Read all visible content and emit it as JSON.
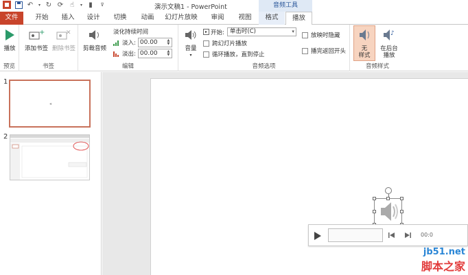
{
  "titlebar": {
    "doc_title": "演示文稿1 - PowerPoint",
    "ctx_title": "音频工具"
  },
  "tabs": [
    "文件",
    "开始",
    "插入",
    "设计",
    "切换",
    "动画",
    "幻灯片放映",
    "审阅",
    "视图",
    "格式",
    "播放"
  ],
  "ribbon": {
    "preview": {
      "play_label": "播放",
      "group_label": "预览"
    },
    "bookmarks": {
      "add_label": "添加书签",
      "remove_label": "删除书签",
      "group_label": "书签"
    },
    "editing": {
      "trim_label": "剪裁音频",
      "fade_title": "淡化持续时间",
      "fade_in_label": "淡入:",
      "fade_in_value": "00.00",
      "fade_out_label": "淡出:",
      "fade_out_value": "00.00",
      "group_label": "编辑"
    },
    "audio_options": {
      "volume_label": "音量",
      "start_label": "开始:",
      "start_value": "单击时(C)",
      "cross_slides_label": "跨幻灯片播放",
      "loop_label": "循环播放，直到停止",
      "hide_label": "放映时隐藏",
      "rewind_label": "播完返回开头",
      "group_label": "音频选项"
    },
    "audio_styles": {
      "no_style_label": "无\n样式",
      "bg_play_label": "在后台\n播放",
      "group_label": "音频样式"
    }
  },
  "thumbnails": [
    {
      "number": "1"
    },
    {
      "number": "2"
    }
  ],
  "player": {
    "time": "00:0"
  },
  "watermark": {
    "line1": "jb51.net",
    "line2": "脚本之家"
  },
  "colors": {
    "file_tab": "#c8442b",
    "accent": "#2b579a",
    "selected_thumb": "#c8715a"
  }
}
